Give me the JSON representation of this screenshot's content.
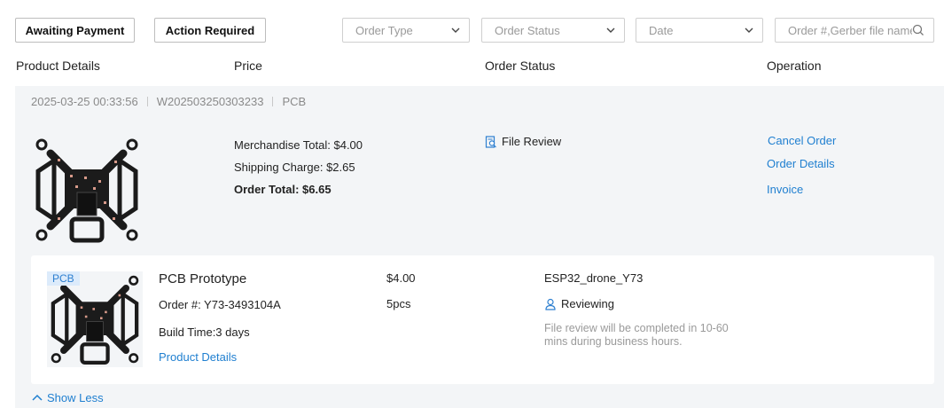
{
  "filters": {
    "awaiting_payment": "Awaiting Payment",
    "action_required": "Action Required"
  },
  "selects": {
    "order_type": "Order Type",
    "order_status": "Order Status",
    "date": "Date"
  },
  "search": {
    "placeholder": "Order #,Gerber file name"
  },
  "columns": {
    "product_details": "Product Details",
    "price": "Price",
    "order_status": "Order Status",
    "operation": "Operation"
  },
  "order": {
    "datetime": "2025-03-25 00:33:56",
    "number": "W202503250303233",
    "type": "PCB",
    "merchandise_total": "Merchandise Total: $4.00",
    "shipping_charge": "Shipping Charge: $2.65",
    "order_total": "Order Total: $6.65",
    "status": "File Review",
    "operations": {
      "cancel": "Cancel Order",
      "details": "Order Details",
      "invoice": "Invoice"
    },
    "item": {
      "tag": "PCB",
      "name": "PCB Prototype",
      "order_no": "Order #: Y73-3493104A",
      "build_time": "Build Time:3 days",
      "details_link": "Product Details",
      "price": "$4.00",
      "quantity": "5pcs",
      "file_name": "ESP32_drone_Y73",
      "status": "Reviewing",
      "note": "File review will be completed in 10-60 mins during business hours."
    }
  },
  "show_less": "Show Less",
  "colors": {
    "link": "#1f7fd0",
    "block_bg": "#f3f5f7",
    "tag_bg": "#dcebfb"
  }
}
